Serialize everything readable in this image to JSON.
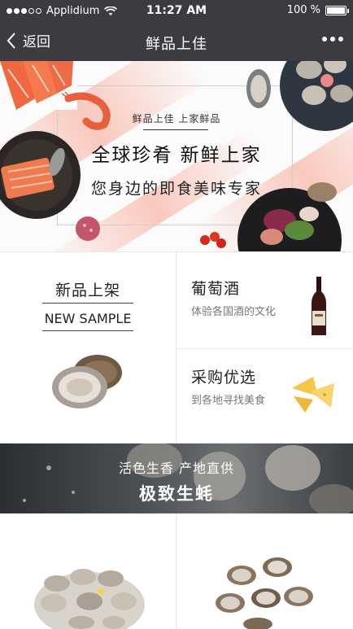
{
  "status_bar": {
    "carrier": "Applidium",
    "time": "11:27 AM",
    "battery": "100 %"
  },
  "nav": {
    "back_label": "返回",
    "title": "鲜品上佳"
  },
  "banner": {
    "small_text": "鲜品上佳 上家鲜品",
    "headline": "全球珍肴  新鲜上家",
    "subline": "您身边的即食美味专家"
  },
  "grid": {
    "new_title": "新品上架",
    "new_en": "NEW SAMPLE",
    "wine_title": "葡萄酒",
    "wine_sub": "体验各国酒的文化",
    "purchase_title": "采购优选",
    "purchase_sub": "到各地寻找美食"
  },
  "promo": {
    "sub": "活色生香  产地直供",
    "main": "极致生蚝"
  },
  "colors": {
    "topbar": "#3c3b3f",
    "accent_stripe": "#f8a08c"
  }
}
